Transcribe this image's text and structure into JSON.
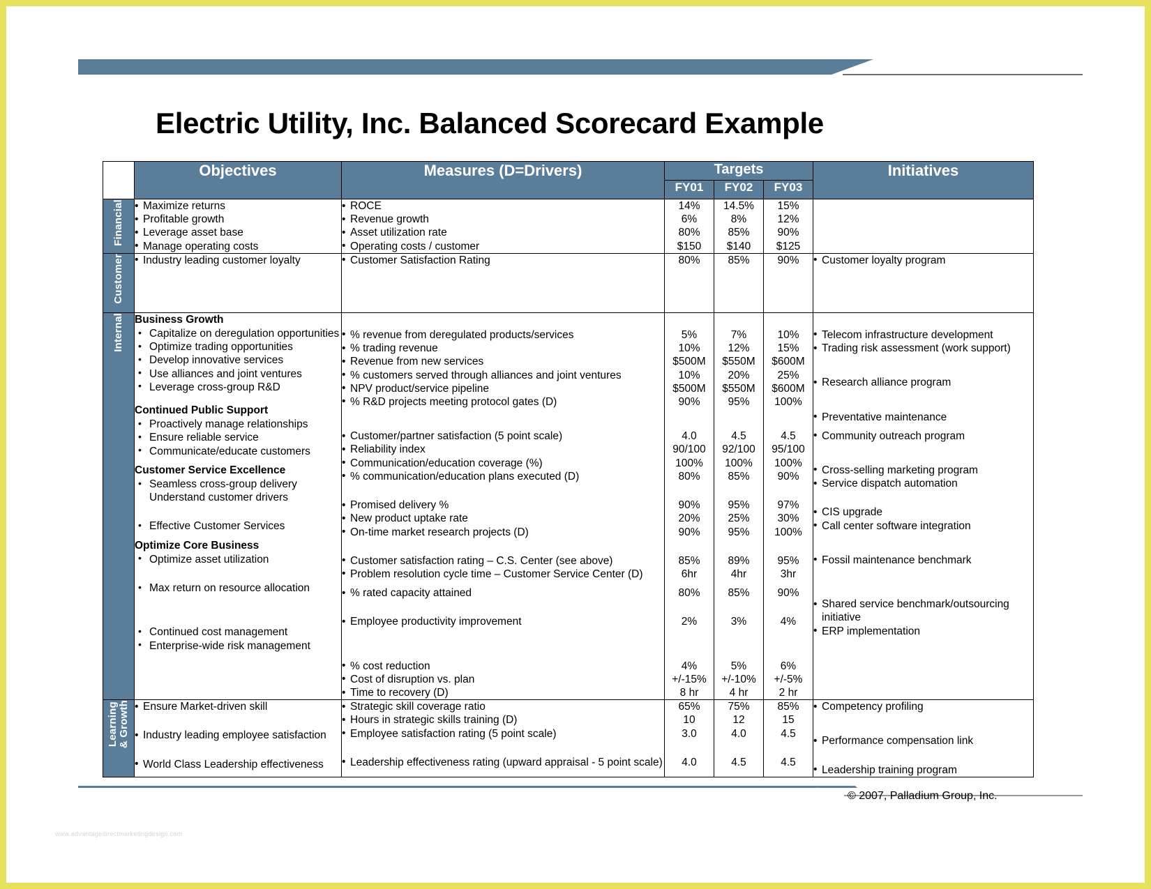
{
  "document": {
    "title": "Electric Utility, Inc.  Balanced Scorecard Example",
    "copyright": "© 2007, Palladium Group, Inc.",
    "watermark": "www.advantagedirectmarketingdesign.com"
  },
  "theme": {
    "header_fill": "#5a7d9a",
    "header_text": "#ffffff",
    "border": "#000000",
    "page_border": "#e8e15c",
    "body_bg": "#ffffff"
  },
  "table": {
    "columns": {
      "objectives": "Objectives",
      "measures": "Measures  (D=Drivers)",
      "targets": "Targets",
      "fy01": "FY01",
      "fy02": "FY02",
      "fy03": "FY03",
      "initiatives": "Initiatives"
    },
    "perspectives": [
      {
        "id": "financial",
        "label": "Financial",
        "objectives": [
          "Maximize returns",
          "Profitable growth",
          "Leverage asset base",
          "Manage operating costs"
        ],
        "measures": [
          "ROCE",
          "Revenue growth",
          "Asset utilization rate",
          "Operating costs / customer"
        ],
        "fy01": [
          "14%",
          "6%",
          "80%",
          "$150"
        ],
        "fy02": [
          "14.5%",
          "8%",
          "85%",
          "$140"
        ],
        "fy03": [
          "15%",
          "12%",
          "90%",
          "$125"
        ],
        "initiatives": []
      },
      {
        "id": "customer",
        "label": "Customer",
        "objectives": [
          "Industry leading customer loyalty"
        ],
        "measures": [
          "Customer Satisfaction Rating"
        ],
        "fy01": [
          "80%"
        ],
        "fy02": [
          "85%"
        ],
        "fy03": [
          "90%"
        ],
        "initiatives": [
          "Customer loyalty program"
        ]
      },
      {
        "id": "internal",
        "label": "Internal",
        "groups": [
          {
            "heading": "Business Growth",
            "objectives": [
              "Capitalize on deregulation opportunities",
              "Optimize trading opportunities",
              "Develop innovative services",
              "Use alliances and joint ventures",
              "Leverage cross-group R&D"
            ],
            "measures": [
              "% revenue from deregulated products/services",
              "% trading revenue",
              "Revenue from new services",
              "% customers served through alliances and joint ventures",
              "NPV product/service pipeline",
              "% R&D projects meeting protocol gates (D)"
            ],
            "fy01": [
              "5%",
              "10%",
              "$500M",
              "10%",
              "$500M",
              "90%"
            ],
            "fy02": [
              "7%",
              "12%",
              "$550M",
              "20%",
              "$550M",
              "95%"
            ],
            "fy03": [
              "10%",
              "15%",
              "$600M",
              "25%",
              "$600M",
              "100%"
            ],
            "initiatives": [
              "Telecom infrastructure development",
              "Trading risk assessment (work support)",
              "Research alliance program"
            ]
          },
          {
            "heading": "Continued Public Support",
            "objectives": [
              "Proactively manage relationships",
              "Ensure reliable service",
              "Communicate/educate customers"
            ],
            "measures": [
              "Customer/partner satisfaction (5 point scale)",
              "Reliability index",
              "Communication/education coverage (%)",
              "% communication/education plans executed (D)"
            ],
            "fy01": [
              "4.0",
              "90/100",
              "100%",
              "80%"
            ],
            "fy02": [
              "4.5",
              "92/100",
              "100%",
              "85%"
            ],
            "fy03": [
              "4.5",
              "95/100",
              "100%",
              "90%"
            ],
            "initiatives": [
              "Preventative maintenance",
              "Community outreach program"
            ]
          },
          {
            "heading": "Customer Service Excellence",
            "objectives": [
              "Seamless cross-group delivery",
              "Understand customer drivers"
            ],
            "measures": [
              "Promised delivery %",
              "New product uptake rate",
              "On-time market research projects (D)"
            ],
            "fy01": [
              "90%",
              "20%",
              "90%"
            ],
            "fy02": [
              "95%",
              "25%",
              "95%"
            ],
            "fy03": [
              "97%",
              "30%",
              "100%"
            ],
            "initiatives": [
              "Cross-selling marketing program",
              "Service dispatch automation"
            ]
          },
          {
            "heading": "",
            "objectives": [
              "Effective Customer Services"
            ],
            "measures": [
              "Customer satisfaction rating – C.S. Center (see above)",
              "Problem resolution cycle time – Customer Service Center (D)"
            ],
            "fy01": [
              "85%",
              "6hr"
            ],
            "fy02": [
              "89%",
              "4hr"
            ],
            "fy03": [
              "95%",
              "3hr"
            ],
            "initiatives": [
              "CIS upgrade",
              "Call center software integration"
            ]
          },
          {
            "heading": "Optimize Core Business",
            "objectives": [
              "Optimize asset utilization"
            ],
            "measures": [
              "% rated capacity attained"
            ],
            "fy01": [
              "80%"
            ],
            "fy02": [
              "85%"
            ],
            "fy03": [
              "90%"
            ],
            "initiatives": []
          },
          {
            "heading": "",
            "objectives": [
              "Max return on resource allocation"
            ],
            "measures": [
              "Employee productivity improvement"
            ],
            "fy01": [
              "2%"
            ],
            "fy02": [
              "3%"
            ],
            "fy03": [
              "4%"
            ],
            "initiatives": [
              "Fossil maintenance benchmark"
            ]
          },
          {
            "heading": "",
            "objectives": [
              "Continued cost management",
              "Enterprise-wide risk management"
            ],
            "measures": [
              "% cost reduction",
              "Cost of disruption vs. plan",
              "Time to recovery (D)"
            ],
            "fy01": [
              "4%",
              "+/-15%",
              "8 hr"
            ],
            "fy02": [
              "5%",
              "+/-10%",
              "4 hr"
            ],
            "fy03": [
              "6%",
              "+/-5%",
              "2 hr"
            ],
            "initiatives": [
              "Shared service benchmark/outsourcing initiative",
              "ERP implementation"
            ]
          }
        ]
      },
      {
        "id": "learning",
        "label": "Learning\n& Growth",
        "label_line1": "Learning",
        "label_line2": "& Growth",
        "objectives": [
          "Ensure Market-driven skill",
          "Industry leading employee satisfaction",
          "World Class Leadership effectiveness"
        ],
        "measures": [
          "Strategic skill coverage ratio",
          "Hours in strategic skills training (D)",
          "Employee satisfaction rating (5 point scale)",
          "Leadership effectiveness rating (upward appraisal - 5 point scale)"
        ],
        "fy01": [
          "65%",
          "10",
          "3.0",
          "4.0"
        ],
        "fy02": [
          "75%",
          "12",
          "4.0",
          "4.5"
        ],
        "fy03": [
          "85%",
          "15",
          "4.5",
          "4.5"
        ],
        "initiatives": [
          "Competency profiling",
          "Performance compensation link",
          "Leadership training program"
        ]
      }
    ]
  }
}
